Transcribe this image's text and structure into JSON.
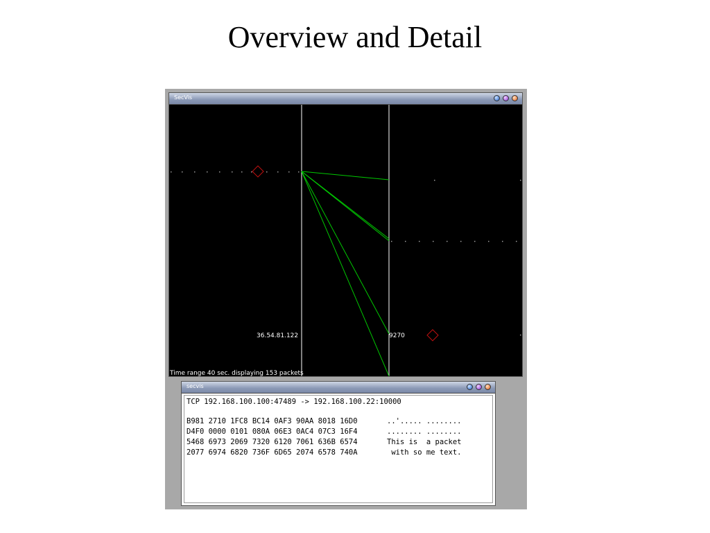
{
  "slide": {
    "title": "Overview and Detail"
  },
  "secvis_window": {
    "title": "SecVis",
    "left_axis_label": "36.54.81.122",
    "right_axis_label": "9270",
    "status_text": "Time range 40 sec. displaying 153 packets",
    "colors": {
      "background": "#000000",
      "axis": "#ffffff",
      "link": "#00c800",
      "marker": "#c01010",
      "dot": "#9a9a9a"
    }
  },
  "packet_window": {
    "title": "secvis",
    "connection": "TCP 192.168.100.100:47489 -> 192.168.100.22:10000",
    "hex_rows": [
      "B981 2710 1FC8 BC14 0AF3 90AA 8018 16D0",
      "D4F0 0000 0101 080A 06E3 0AC4 07C3 16F4",
      "5468 6973 2069 7320 6120 7061 636B 6574",
      "2077 6974 6820 736F 6D65 2074 6578 740A"
    ],
    "ascii_rows": [
      "..'..... ........",
      "........ ........",
      "This is  a packet",
      " with so me text."
    ]
  }
}
